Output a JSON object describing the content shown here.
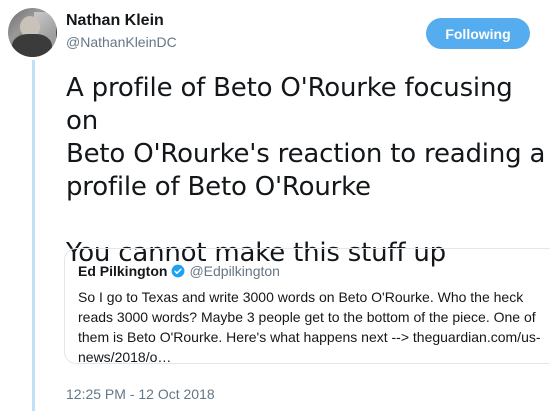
{
  "author": {
    "display_name": "Nathan Klein",
    "handle": "@NathanKleinDC",
    "avatar": "avatar"
  },
  "follow_button": {
    "label": "Following",
    "color": "#55acee"
  },
  "tweet": {
    "text": "A profile of Beto O'Rourke focusing on\nBeto O'Rourke's reaction to reading a\nprofile of Beto O'Rourke\n\nYou cannot make this stuff up",
    "timestamp": "12:25 PM - 12 Oct 2018"
  },
  "quoted_tweet": {
    "display_name": "Ed Pilkington",
    "verified_icon": "verified-badge-icon",
    "handle": "@Edpilkington",
    "text": "So I go to Texas and write 3000 words on Beto O'Rourke. Who the heck reads 3000 words? Maybe 3 people get to the bottom of the piece. One of them is Beto O'Rourke. Here's what happens next --> theguardian.com/us-news/2018/o…"
  },
  "colors": {
    "accent": "#55acee",
    "secondary_text": "#657786",
    "thread_line": "#bfe0f7"
  }
}
